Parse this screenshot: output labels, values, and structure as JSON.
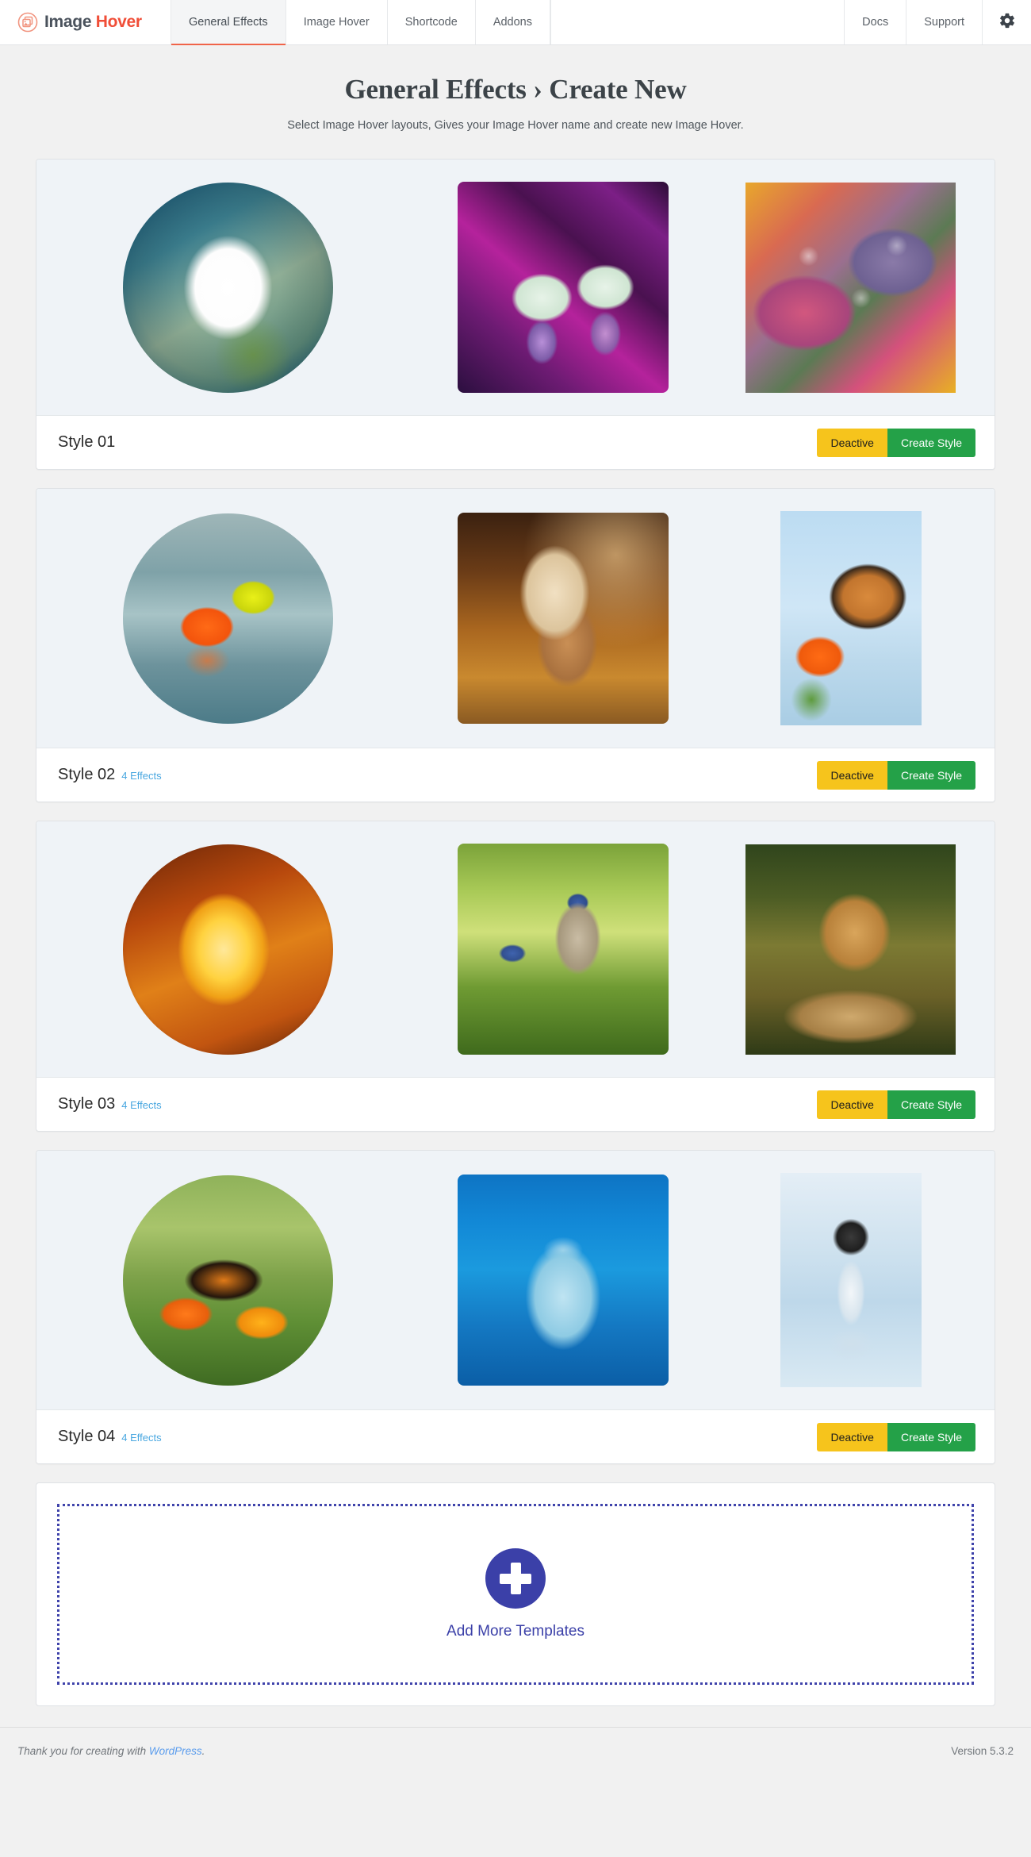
{
  "header": {
    "logo": {
      "icon": "image-hover-logo-icon",
      "word1": "Image",
      "word2": "Hover"
    },
    "nav": [
      {
        "label": "General Effects",
        "active": true
      },
      {
        "label": "Image Hover",
        "active": false
      },
      {
        "label": "Shortcode",
        "active": false
      },
      {
        "label": "Addons",
        "active": false
      }
    ],
    "nav_right": [
      {
        "label": "Docs"
      },
      {
        "label": "Support"
      }
    ],
    "settings_icon": "gear-icon",
    "accent_color": "#f06449"
  },
  "page": {
    "title": "General Effects › Create New",
    "subtitle": "Select Image Hover layouts, Gives your Image Hover name and create new Image Hover."
  },
  "buttons": {
    "deactive_label": "Deactive",
    "create_label": "Create Style",
    "deactive_color": "#f6c41c",
    "create_color": "#24a148"
  },
  "styles": [
    {
      "name": "Style 01",
      "effects": "",
      "deactive_label": "Deactive",
      "create_label": "Create Style",
      "thumbs": [
        {
          "name": "daisy-flower-thumbnail",
          "shape": "circle"
        },
        {
          "name": "lily-of-the-valley-thumbnail",
          "shape": "rounded"
        },
        {
          "name": "dewy-autumn-leaves-thumbnail",
          "shape": "square"
        }
      ]
    },
    {
      "name": "Style 02",
      "effects": "4 Effects",
      "deactive_label": "Deactive",
      "create_label": "Create Style",
      "thumbs": [
        {
          "name": "origami-boat-thumbnail",
          "shape": "circle"
        },
        {
          "name": "horse-running-thumbnail",
          "shape": "rounded"
        },
        {
          "name": "butterfly-on-flower-thumbnail",
          "shape": "tall"
        }
      ]
    },
    {
      "name": "Style 03",
      "effects": "4 Effects",
      "deactive_label": "Deactive",
      "create_label": "Create Style",
      "thumbs": [
        {
          "name": "glowing-lantern-flower-thumbnail",
          "shape": "circle"
        },
        {
          "name": "bluebirds-birdhouse-thumbnail",
          "shape": "rounded"
        },
        {
          "name": "lion-resting-thumbnail",
          "shape": "square"
        }
      ]
    },
    {
      "name": "Style 04",
      "effects": "4 Effects",
      "deactive_label": "Deactive",
      "create_label": "Create Style",
      "thumbs": [
        {
          "name": "monarch-butterfly-marigold-thumbnail",
          "shape": "circle"
        },
        {
          "name": "dolphin-underwater-thumbnail",
          "shape": "rounded"
        },
        {
          "name": "husky-puppy-snow-thumbnail",
          "shape": "tall"
        }
      ]
    }
  ],
  "add_more": {
    "label": "Add More Templates",
    "icon": "plus-icon",
    "color": "#3b40a8"
  },
  "footer": {
    "thanks_prefix": "Thank you for creating with ",
    "wordpress_link": "WordPress",
    "thanks_suffix": ".",
    "version": "Version 5.3.2"
  }
}
